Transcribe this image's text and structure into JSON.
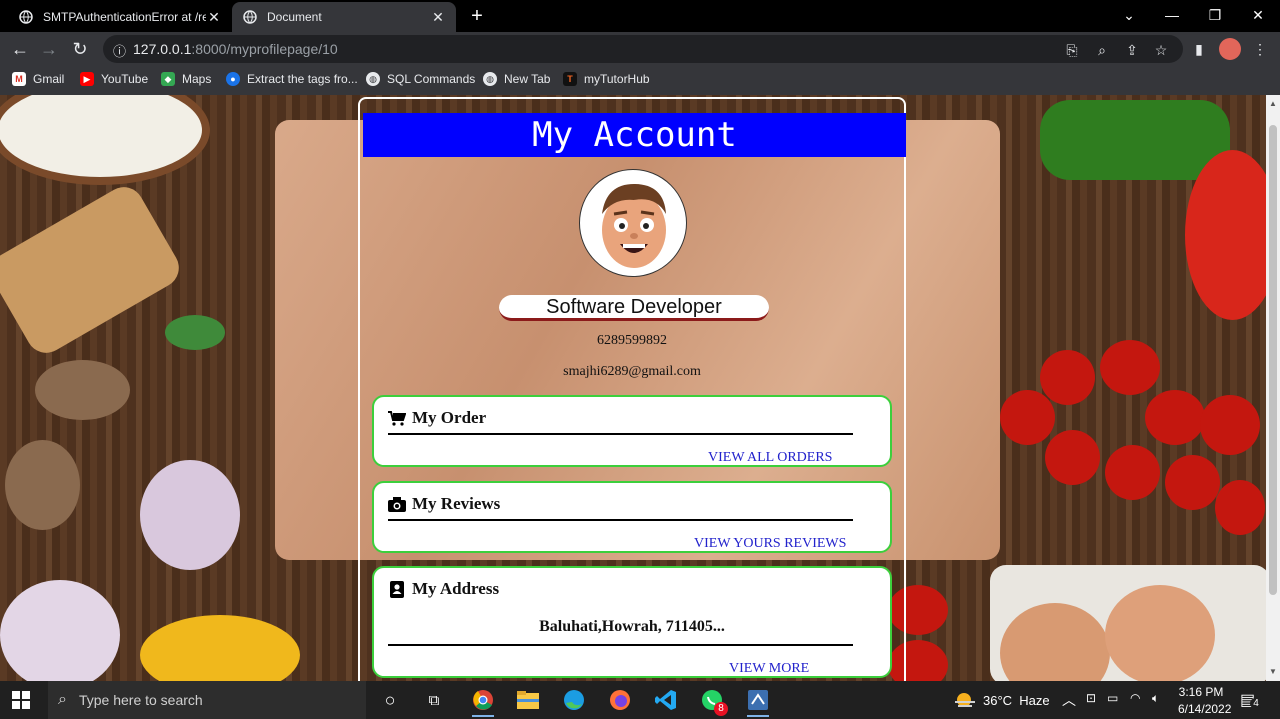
{
  "tabs": [
    {
      "title": "SMTPAuthenticationError at /reg",
      "active": false
    },
    {
      "title": "Document",
      "active": true
    }
  ],
  "address_bar": {
    "host": "127.0.0.1",
    "path": ":8000/myprofilepage/10"
  },
  "bookmarks": [
    "Gmail",
    "YouTube",
    "Maps",
    "Extract the tags fro...",
    "SQL Commands",
    "New Tab",
    "myTutorHub"
  ],
  "page": {
    "header": "My Account",
    "job_title": "Software Developer",
    "phone": "6289599892",
    "email": "smajhi6289@gmail.com",
    "sections": {
      "orders": {
        "title": "My Order",
        "link": "VIEW ALL ORDERS"
      },
      "reviews": {
        "title": "My Reviews",
        "link": "VIEW YOURS REVIEWS"
      },
      "address": {
        "title": "My Address",
        "value": "Baluhati,Howrah, 711405...",
        "link": "VIEW MORE"
      }
    }
  },
  "colors": {
    "header_bg": "#0000ff",
    "section_border": "#3ccf3c",
    "link": "#2222cc"
  },
  "taskbar": {
    "search_placeholder": "Type here to search",
    "weather": "36°C  Haze",
    "time": "3:16 PM",
    "date": "6/14/2022",
    "whatsapp_badge": "8",
    "notification_count": "4"
  }
}
